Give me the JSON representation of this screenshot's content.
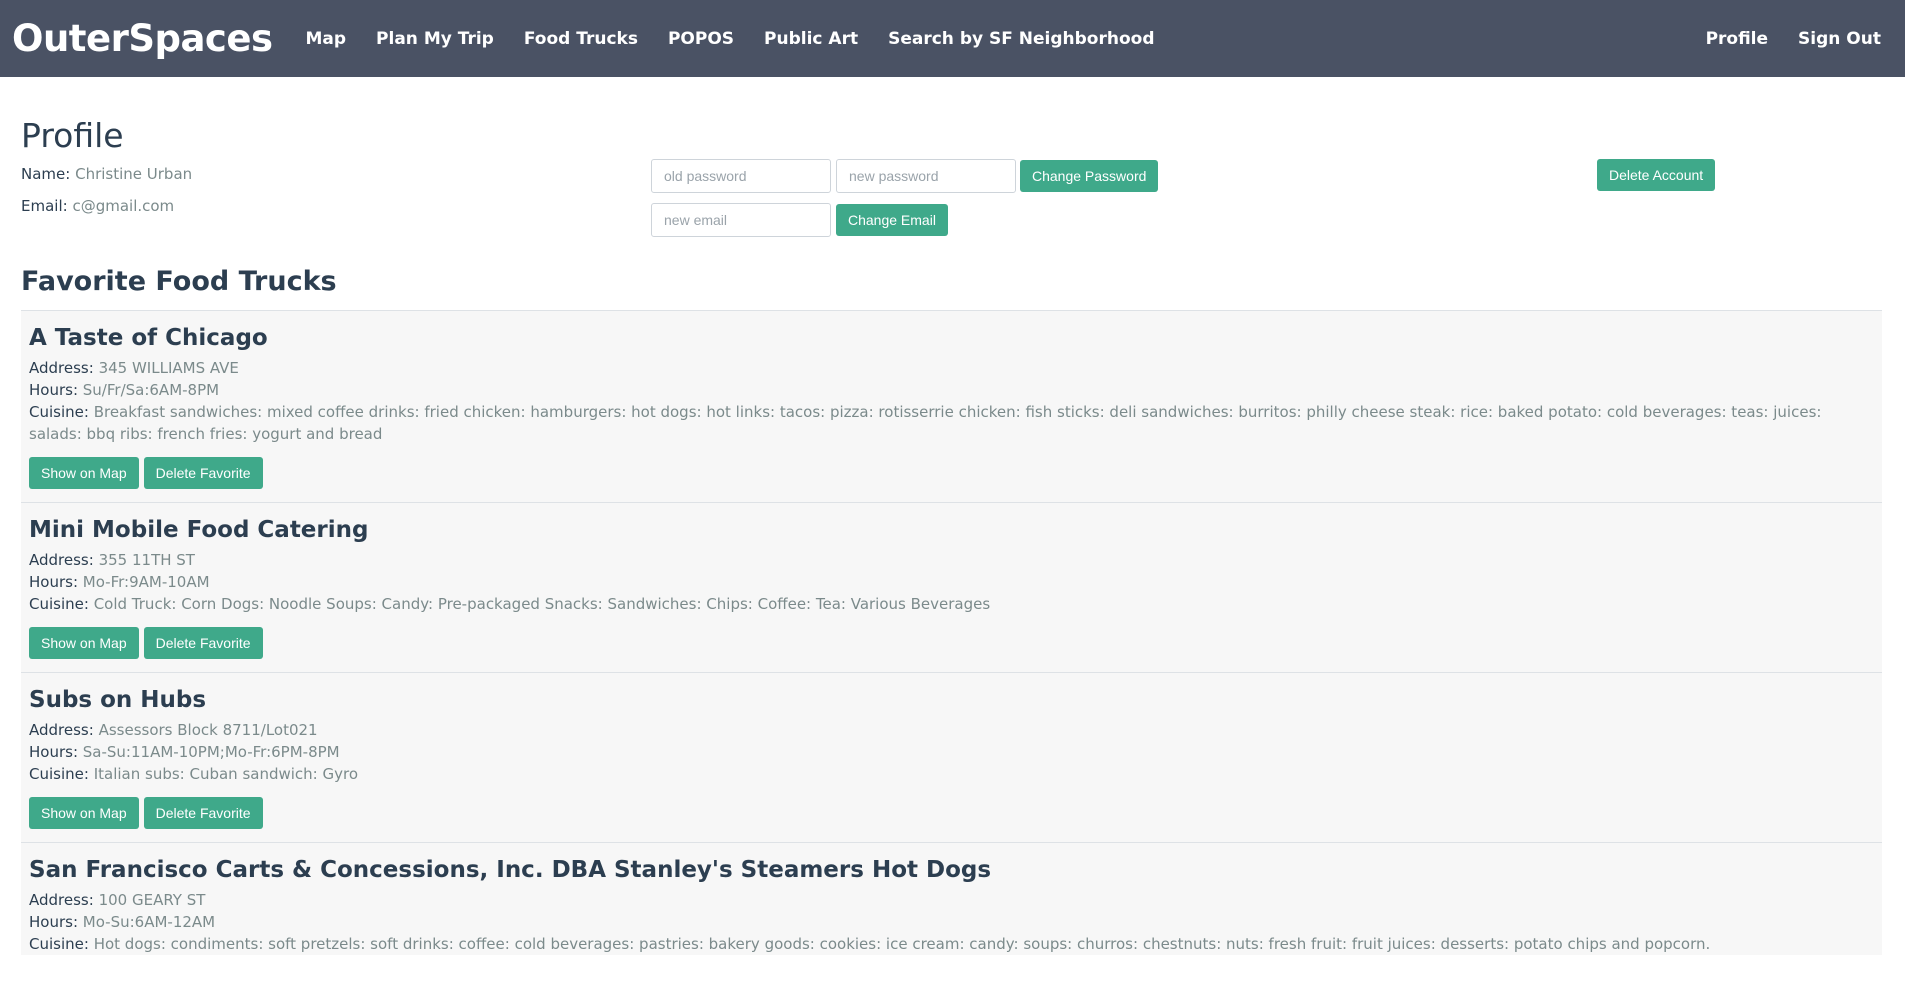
{
  "nav": {
    "brand": "OuterSpaces",
    "links": [
      "Map",
      "Plan My Trip",
      "Food Trucks",
      "POPOS",
      "Public Art",
      "Search by SF Neighborhood"
    ],
    "right_links": [
      "Profile",
      "Sign Out"
    ]
  },
  "profile": {
    "title": "Profile",
    "name_label": "Name:",
    "name_value": "Christine Urban",
    "email_label": "Email:",
    "email_value": "c@gmail.com",
    "old_password_placeholder": "old password",
    "new_password_placeholder": "new password",
    "change_password_label": "Change Password",
    "new_email_placeholder": "new email",
    "change_email_label": "Change Email",
    "delete_account_label": "Delete Account"
  },
  "favorites": {
    "title": "Favorite Food Trucks",
    "address_label": "Address:",
    "hours_label": "Hours:",
    "cuisine_label": "Cuisine:",
    "show_on_map_label": "Show on Map",
    "delete_favorite_label": "Delete Favorite",
    "items": [
      {
        "name": "A Taste of Chicago",
        "address": "345 WILLIAMS AVE",
        "hours": "Su/Fr/Sa:6AM-8PM",
        "cuisine": "Breakfast sandwiches: mixed coffee drinks: fried chicken: hamburgers: hot dogs: hot links: tacos: pizza: rotisserrie chicken: fish sticks: deli sandwiches: burritos: philly cheese steak: rice: baked potato: cold beverages: teas: juices: salads: bbq ribs: french fries: yogurt and bread"
      },
      {
        "name": "Mini Mobile Food Catering",
        "address": "355 11TH ST",
        "hours": "Mo-Fr:9AM-10AM",
        "cuisine": "Cold Truck: Corn Dogs: Noodle Soups: Candy: Pre-packaged Snacks: Sandwiches: Chips: Coffee: Tea: Various Beverages"
      },
      {
        "name": "Subs on Hubs",
        "address": "Assessors Block 8711/Lot021",
        "hours": "Sa-Su:11AM-10PM;Mo-Fr:6PM-8PM",
        "cuisine": "Italian subs: Cuban sandwich: Gyro"
      },
      {
        "name": "San Francisco Carts & Concessions, Inc. DBA Stanley's Steamers Hot Dogs",
        "address": "100 GEARY ST",
        "hours": "Mo-Su:6AM-12AM",
        "cuisine": "Hot dogs: condiments: soft pretzels: soft drinks: coffee: cold beverages: pastries: bakery goods: cookies: ice cream: candy: soups: churros: chestnuts: nuts: fresh fruit: fruit juices: desserts: potato chips and popcorn."
      }
    ]
  }
}
